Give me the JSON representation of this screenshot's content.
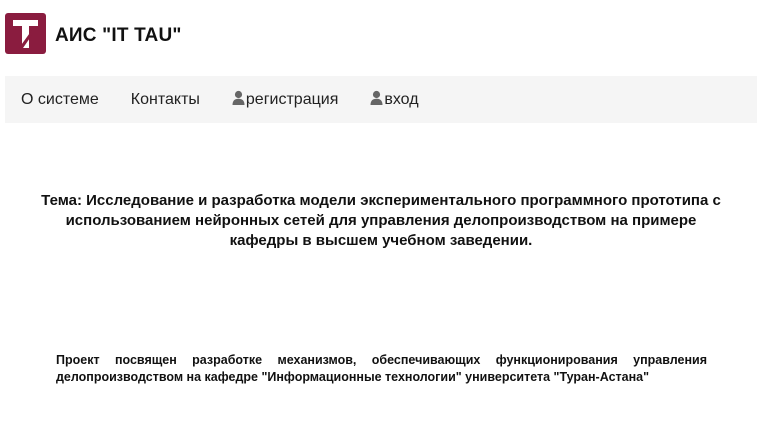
{
  "header": {
    "logo_letter": "T",
    "title": "АИС \"IT TAU\""
  },
  "nav": {
    "items": [
      {
        "label": "О системе",
        "icon": null
      },
      {
        "label": "Контакты",
        "icon": null
      },
      {
        "label": "регистрация",
        "icon": "user-icon"
      },
      {
        "label": "вход",
        "icon": "user-icon"
      }
    ]
  },
  "main": {
    "topic": "Тема: Исследование и разработка модели экспериментального программного прототипа с использованием нейронных сетей для управления делопроизводством на примере кафедры в высшем учебном заведении.",
    "description": "Проект посвящен разработке механизмов, обеспечивающих функционирования управления делопроизводством на кафедре \"Информационные технологии\" университета \"Туран-Астана\""
  },
  "colors": {
    "brand": "#8a1c3f",
    "navbar_bg": "#f5f5f5",
    "icon_gray": "#666666"
  }
}
